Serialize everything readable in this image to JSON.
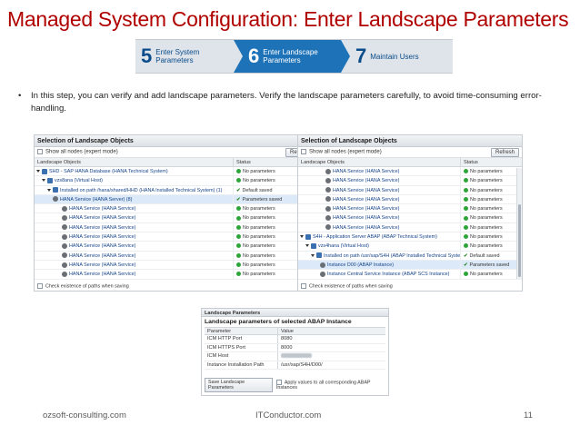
{
  "slide": {
    "title": "Managed System Configuration: Enter Landscape Parameters",
    "bullet": "In this step, you can verify and add landscape parameters. Verify the landscape parameters carefully, to avoid time-consuming error-handling."
  },
  "steps": [
    {
      "num": "5",
      "line1": "Enter System",
      "line2": "Parameters",
      "active": false
    },
    {
      "num": "6",
      "line1": "Enter Landscape",
      "line2": "Parameters",
      "active": true
    },
    {
      "num": "7",
      "line1": "Maintain Users",
      "line2": "",
      "active": false
    }
  ],
  "left_panel": {
    "title": "Selection of Landscape Objects",
    "show_all": "Show all nodes (expert mode)",
    "refresh": "Refresh",
    "col_objects": "Landscape Objects",
    "col_status": "Status",
    "rows": [
      {
        "indent": 2,
        "icon": "sys",
        "text": "SHD - SAP HANA Database (HANA Technical System)",
        "status": "No parameters",
        "kind": "dot"
      },
      {
        "indent": 8,
        "icon": "sys",
        "text": "vzs8ana (Virtual Host)",
        "status": "No parameters",
        "kind": "dot"
      },
      {
        "indent": 14,
        "icon": "sys",
        "text": "Installed on path /hana/shared/HHD (HANA Installed Technical System) (1)",
        "status": "Default saved",
        "kind": "check"
      },
      {
        "indent": 20,
        "icon": "svc",
        "text": "HANA Service (HANA Server) (8)",
        "status": "Parameters saved",
        "kind": "check",
        "selected": true
      },
      {
        "indent": 30,
        "icon": "svc",
        "text": "HANA Service (HANA Service)",
        "status": "No parameters",
        "kind": "dot"
      },
      {
        "indent": 30,
        "icon": "svc",
        "text": "HANA Service (HANA Service)",
        "status": "No parameters",
        "kind": "dot"
      },
      {
        "indent": 30,
        "icon": "svc",
        "text": "HANA Service (HANA Service)",
        "status": "No parameters",
        "kind": "dot"
      },
      {
        "indent": 30,
        "icon": "svc",
        "text": "HANA Service (HANA Service)",
        "status": "No parameters",
        "kind": "dot"
      },
      {
        "indent": 30,
        "icon": "svc",
        "text": "HANA Service (HANA Service)",
        "status": "No parameters",
        "kind": "dot"
      },
      {
        "indent": 30,
        "icon": "svc",
        "text": "HANA Service (HANA Service)",
        "status": "No parameters",
        "kind": "dot"
      },
      {
        "indent": 30,
        "icon": "svc",
        "text": "HANA Service (HANA Service)",
        "status": "No parameters",
        "kind": "dot"
      },
      {
        "indent": 30,
        "icon": "svc",
        "text": "HANA Service (HANA Service)",
        "status": "No parameters",
        "kind": "dot"
      }
    ],
    "check_paths": "Check existence of paths when saving"
  },
  "right_panel": {
    "title": "Selection of Landscape Objects",
    "show_all": "Show all nodes (expert mode)",
    "refresh": "Refresh",
    "col_objects": "Landscape Objects",
    "col_status": "Status",
    "rows": [
      {
        "indent": 30,
        "icon": "svc",
        "text": "HANA Service (HANA Service)",
        "status": "No parameters",
        "kind": "dot"
      },
      {
        "indent": 30,
        "icon": "svc",
        "text": "HANA Service (HANA Service)",
        "status": "No parameters",
        "kind": "dot"
      },
      {
        "indent": 30,
        "icon": "svc",
        "text": "HANA Service (HANA Service)",
        "status": "No parameters",
        "kind": "dot"
      },
      {
        "indent": 30,
        "icon": "svc",
        "text": "HANA Service (HANA Service)",
        "status": "No parameters",
        "kind": "dot"
      },
      {
        "indent": 30,
        "icon": "svc",
        "text": "HANA Service (HANA Service)",
        "status": "No parameters",
        "kind": "dot"
      },
      {
        "indent": 30,
        "icon": "svc",
        "text": "HANA Service (HANA Service)",
        "status": "No parameters",
        "kind": "dot"
      },
      {
        "indent": 30,
        "icon": "svc",
        "text": "HANA Service (HANA Service)",
        "status": "No parameters",
        "kind": "dot"
      },
      {
        "indent": 2,
        "icon": "sys",
        "text": "S4H - Application Server ABAP (ABAP Technical System)",
        "status": "No parameters",
        "kind": "dot"
      },
      {
        "indent": 8,
        "icon": "sys",
        "text": "vzs4hana (Virtual Host)",
        "status": "No parameters",
        "kind": "dot"
      },
      {
        "indent": 14,
        "icon": "sys",
        "text": "Installed on path /usr/sap/S4H (ABAP Installed Technical System) (2)",
        "status": "Default saved",
        "kind": "check"
      },
      {
        "indent": 24,
        "icon": "svc",
        "text": "Instance D00 (ABAP Instance)",
        "status": "Parameters saved",
        "kind": "check",
        "selected": true
      },
      {
        "indent": 24,
        "icon": "svc",
        "text": "Instance Central Service Instance (ABAP SCS Instance)",
        "status": "No parameters",
        "kind": "dot"
      }
    ],
    "check_paths": "Check existence of paths when saving"
  },
  "detail": {
    "header": "Landscape Parameters",
    "subtitle": "Landscape parameters of selected ABAP Instance",
    "col_param": "Parameter",
    "col_value": "Value",
    "rows": [
      {
        "param": "ICM HTTP Port",
        "value": "8080"
      },
      {
        "param": "ICM HTTPS Port",
        "value": "8000"
      },
      {
        "param": "ICM Host",
        "value": ""
      },
      {
        "param": "Instance Installation Path",
        "value": "/usr/sap/S4H/D00/"
      }
    ],
    "save_button": "Save Landscape Parameters",
    "apply_label": "Apply values to all corresponding ABAP Instances"
  },
  "footer": {
    "left": "ozsoft-consulting.com",
    "center": "ITConductor.com",
    "page": "11"
  }
}
